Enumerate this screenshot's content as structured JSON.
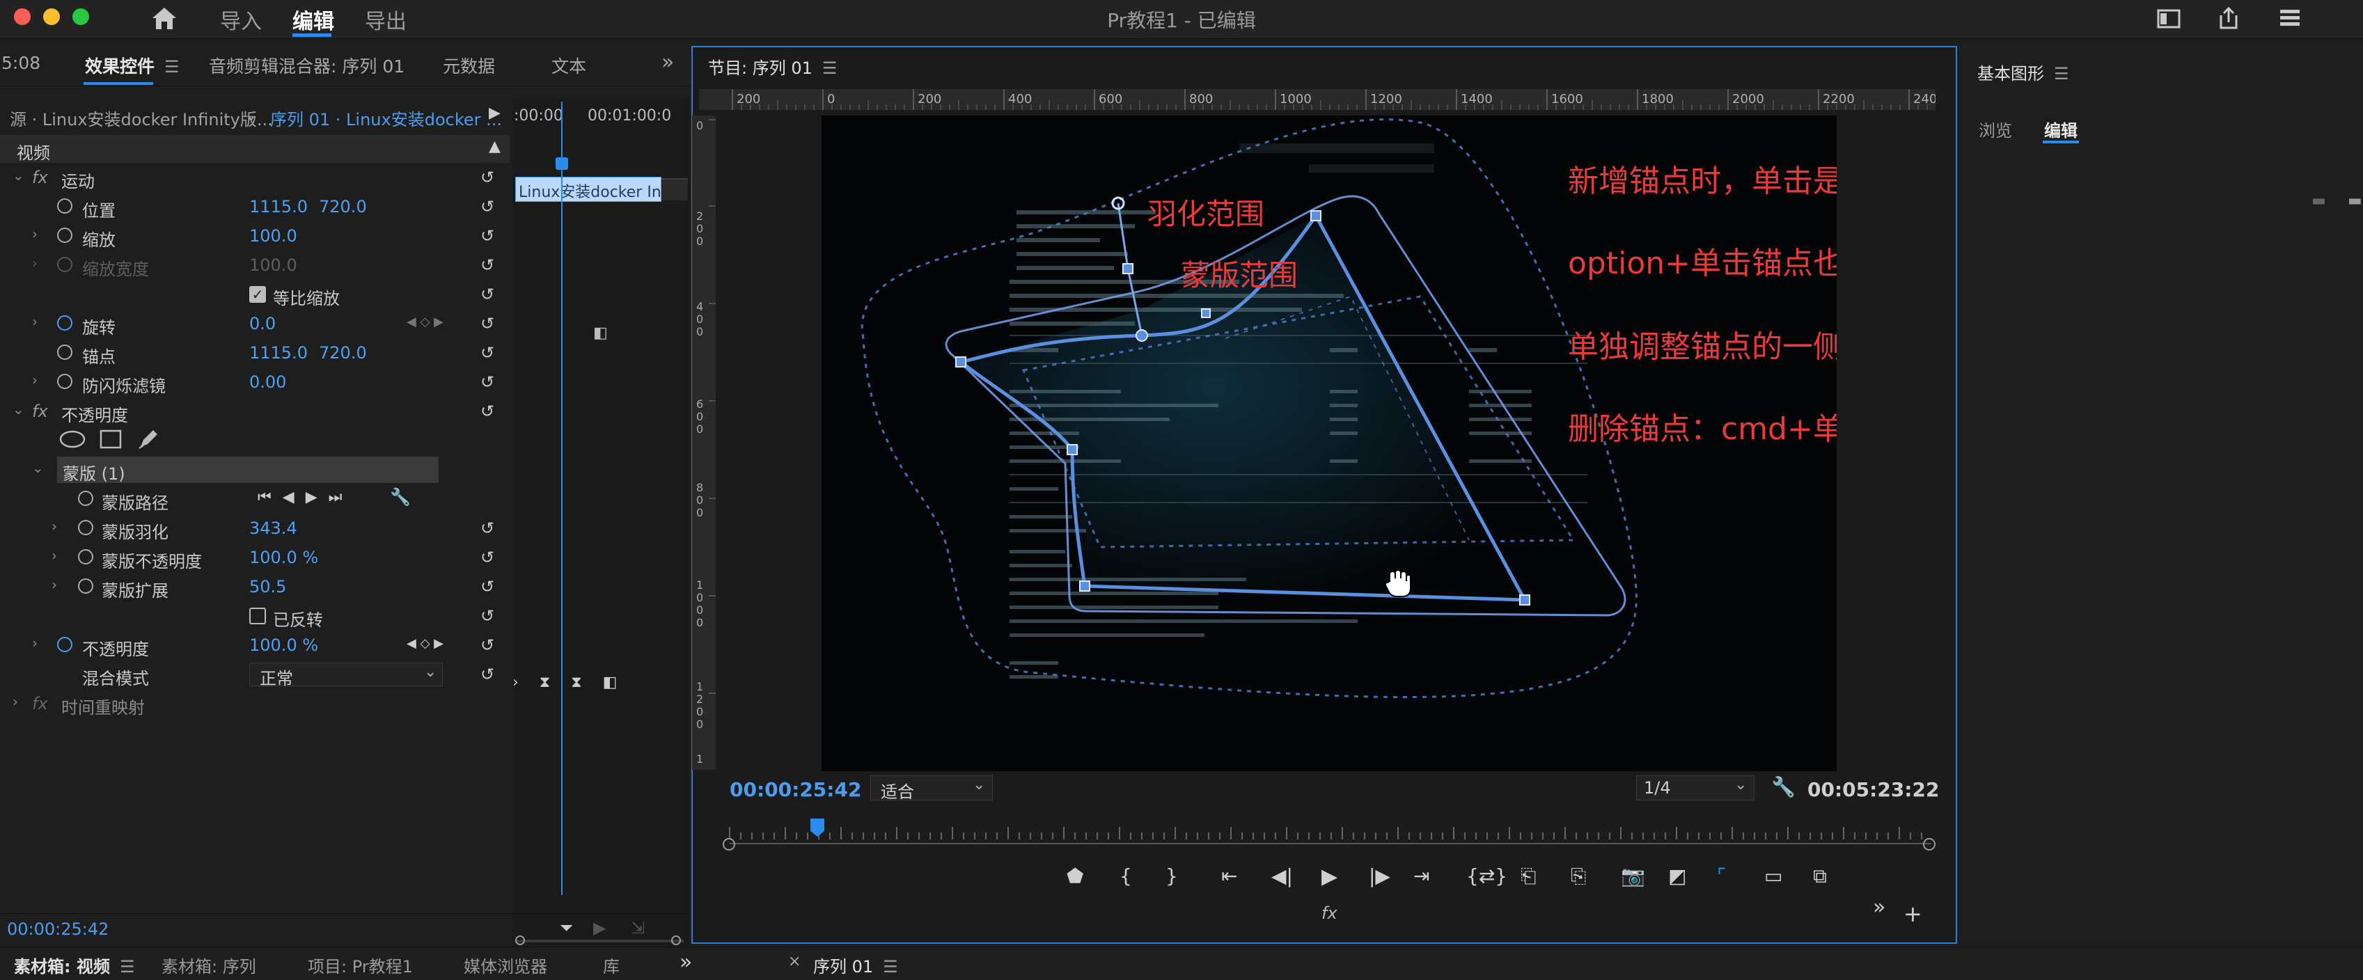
{
  "titlebar": {
    "app_title": "Pr教程1 - 已编辑",
    "menu": [
      "导入",
      "编辑",
      "导出"
    ],
    "active_menu": "编辑"
  },
  "effect_panel": {
    "time_fragment": "5:08",
    "tabs": [
      "效果控件",
      "音频剪辑混合器: 序列 01",
      "元数据",
      "文本"
    ],
    "source_label": "源 · Linux安装docker Infinity版...",
    "sequence_label": "序列 01 · Linux安装docker ...",
    "ruler_start": ":00:00",
    "ruler_end": "00:01:00:0",
    "clip_label": "Linux安装docker Infi",
    "section_video": "视频",
    "motion": "运动",
    "position_label": "位置",
    "position_x": "1115.0",
    "position_y": "720.0",
    "scale_label": "缩放",
    "scale_value": "100.0",
    "scale_width_label": "缩放宽度",
    "scale_width_value": "100.0",
    "uniform_scale_label": "等比缩放",
    "rotation_label": "旋转",
    "rotation_value": "0.0",
    "anchor_label": "锚点",
    "anchor_x": "1115.0",
    "anchor_y": "720.0",
    "antiflicker_label": "防闪烁滤镜",
    "antiflicker_value": "0.00",
    "opacity_section": "不透明度",
    "mask_label": "蒙版 (1)",
    "mask_path_label": "蒙版路径",
    "mask_feather_label": "蒙版羽化",
    "mask_feather_value": "343.4",
    "mask_opacity_label": "蒙版不透明度",
    "mask_opacity_value": "100.0 %",
    "mask_expansion_label": "蒙版扩展",
    "mask_expansion_value": "50.5",
    "inverted_label": "已反转",
    "opacity_label": "不透明度",
    "opacity_value": "100.0 %",
    "blend_label": "混合模式",
    "blend_value": "正常",
    "time_remap": "时间重映射",
    "current_time": "00:00:25:42"
  },
  "program": {
    "title": "节目: 序列 01",
    "ruler_labels": [
      "200",
      "0",
      "200",
      "400",
      "600",
      "800",
      "1000",
      "1200",
      "1400",
      "1600",
      "1800",
      "2000",
      "2200",
      "240"
    ],
    "current_time": "00:00:25:42",
    "zoom": "适合",
    "resolution": "1/4",
    "duration": "00:05:23:22",
    "fx_label": "fx"
  },
  "annotations": {
    "feather": "羽化范围",
    "mask": "蒙版范围",
    "line1": "新增锚点时，单击是直线，长按是曲线",
    "line2": "option+单击锚点也可以改变锚点两侧是直线或曲线",
    "line3": "单独调整锚点的一侧：option+拖拽手柄",
    "line4": "删除锚点：cmd+单击"
  },
  "right_panel": {
    "title": "基本图形",
    "tabs": [
      "浏览",
      "编辑"
    ]
  },
  "bottom_bar": {
    "tabs": [
      "素材箱: 视频",
      "素材箱: 序列",
      "项目: Pr教程1",
      "媒体浏览器",
      "库"
    ],
    "sequence_tab": "序列 01"
  },
  "colors": {
    "accent": "#2b8cf0",
    "value_blue": "#4ea1f1",
    "annotation_red": "#ea3b3b",
    "mask_blue": "#5b8fe0"
  }
}
